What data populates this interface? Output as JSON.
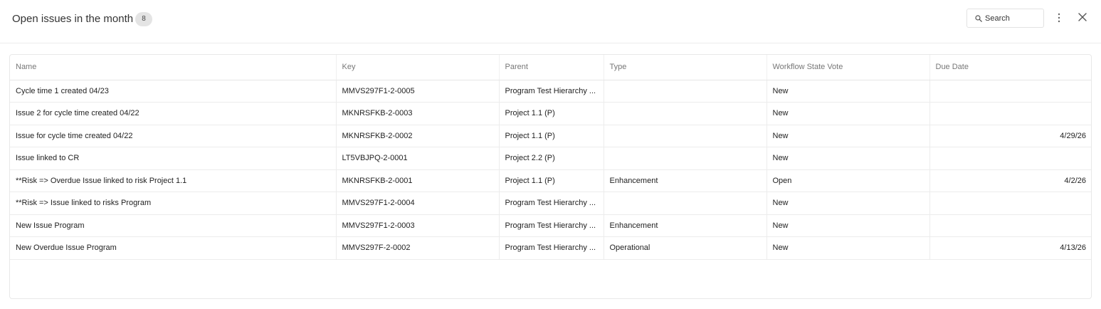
{
  "header": {
    "title": "Open issues in the month",
    "count": "8",
    "search_placeholder": "Search"
  },
  "icons": {
    "search": "search-icon",
    "more": "kebab-menu-icon",
    "close": "close-icon"
  },
  "table": {
    "columns": [
      "Name",
      "Key",
      "Parent",
      "Type",
      "Workflow State Vote",
      "Due Date"
    ],
    "rows": [
      [
        "Cycle time 1 created 04/23",
        "MMVS297F1-2-0005",
        "Program Test Hierarchy ...",
        "",
        "New",
        ""
      ],
      [
        "Issue 2 for cycle time created 04/22",
        "MKNRSFKB-2-0003",
        "Project 1.1 (P)",
        "",
        "New",
        ""
      ],
      [
        "Issue for cycle time created 04/22",
        "MKNRSFKB-2-0002",
        "Project 1.1 (P)",
        "",
        "New",
        "4/29/26"
      ],
      [
        "Issue linked to CR",
        "LT5VBJPQ-2-0001",
        "Project 2.2 (P)",
        "",
        "New",
        ""
      ],
      [
        "**Risk => Overdue Issue linked to risk Project 1.1",
        "MKNRSFKB-2-0001",
        "Project 1.1 (P)",
        "Enhancement",
        "Open",
        "4/2/26"
      ],
      [
        "**Risk => Issue linked to risks Program",
        "MMVS297F1-2-0004",
        "Program Test Hierarchy ...",
        "",
        "New",
        ""
      ],
      [
        "New Issue Program",
        "MMVS297F1-2-0003",
        "Program Test Hierarchy ...",
        "Enhancement",
        "New",
        ""
      ],
      [
        "New Overdue Issue Program",
        "MMVS297F-2-0002",
        "Program Test Hierarchy ...",
        "Operational",
        "New",
        "4/13/26"
      ]
    ]
  }
}
